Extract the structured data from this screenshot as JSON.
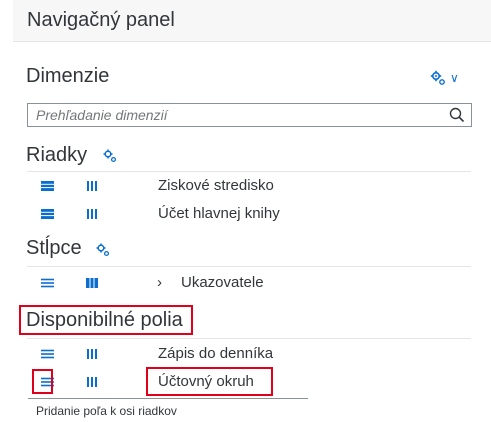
{
  "header": {
    "title": "Navigačný panel"
  },
  "dimensions": {
    "title": "Dimenzie",
    "search_placeholder": "Prehľadanie dimenzií"
  },
  "rows_section": {
    "title": "Riadky",
    "items": [
      {
        "label": "Ziskové stredisko"
      },
      {
        "label": "Účet hlavnej knihy"
      }
    ]
  },
  "columns_section": {
    "title": "Stĺpce",
    "items": [
      {
        "label": "Ukazovatele"
      }
    ]
  },
  "available_section": {
    "title": "Disponibilné polia",
    "items": [
      {
        "label": "Zápis do denníka"
      },
      {
        "label": "Účtovný okruh"
      }
    ]
  },
  "tooltip": {
    "text": "Pridanie poľa k osi riadkov"
  },
  "colors": {
    "accent": "#0a6ed1",
    "highlight": "#e0001b",
    "text": "#32363a"
  }
}
